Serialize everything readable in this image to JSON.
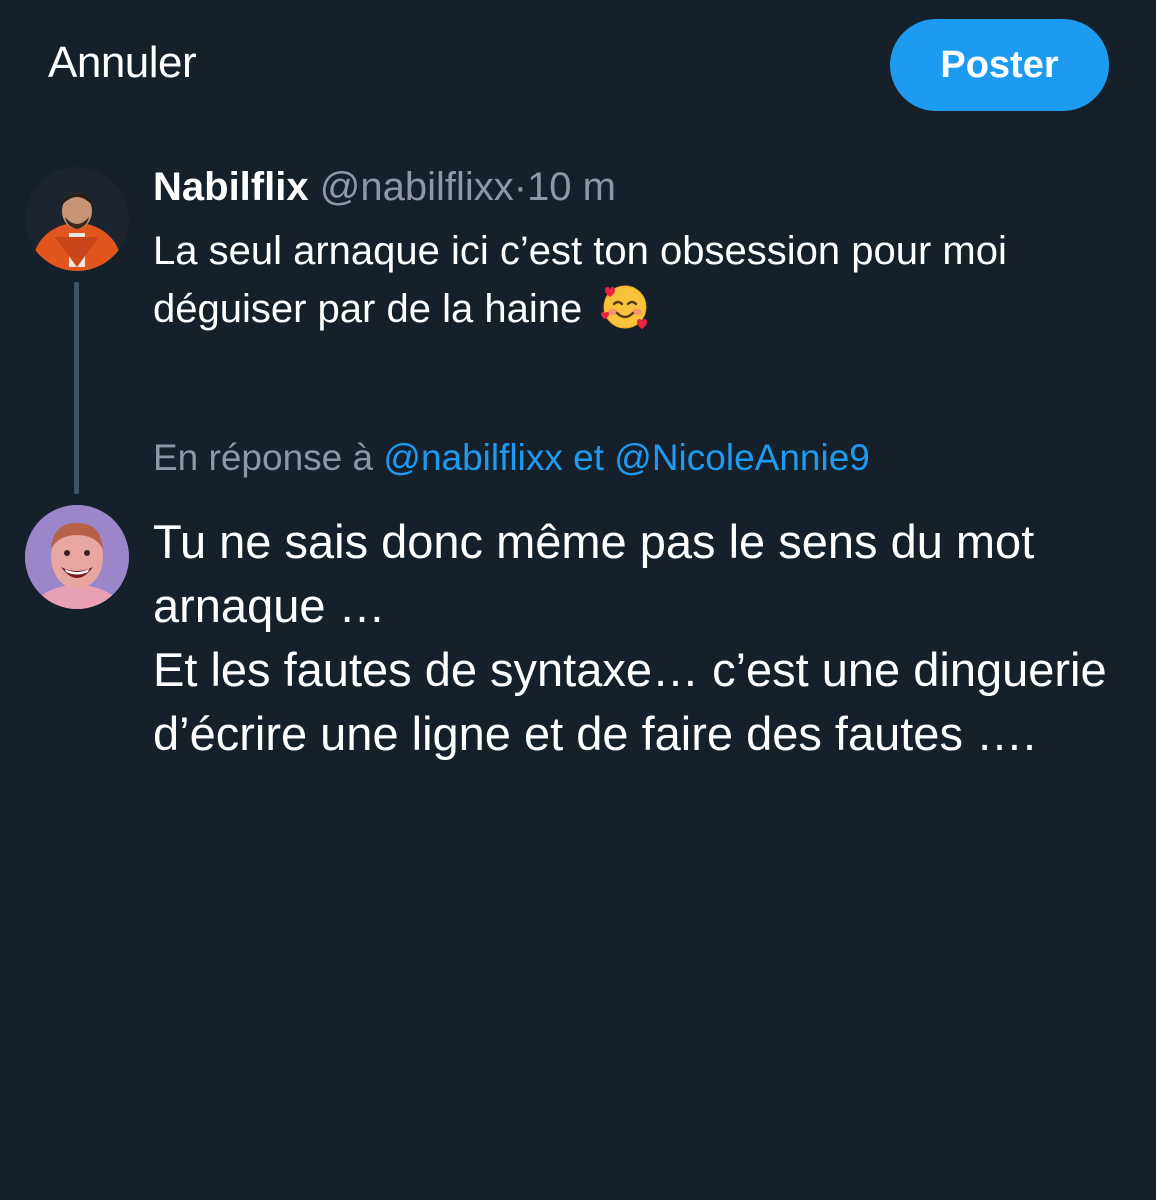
{
  "header": {
    "cancel_label": "Annuler",
    "post_label": "Poster"
  },
  "original_tweet": {
    "display_name": "Nabilflix",
    "handle": "@nabilflixx",
    "separator": "·",
    "time": "10 m",
    "text": "La seul arnaque ici c’est ton obsession pour moi déguiser par de la haine",
    "emoji": "smiling-face-with-hearts"
  },
  "reply_context": {
    "prefix": "En réponse à",
    "mention_1": "@nabilflixx",
    "conjunction": "et",
    "mention_2": "@NicoleAnnie9"
  },
  "compose": {
    "line_1": "Tu ne sais donc même pas le sens du mot arnaque …",
    "line_2": "Et les fautes de syntaxe… c’est une dinguerie d’écrire une ligne et de faire des fautes …."
  },
  "colors": {
    "background": "#15202b",
    "accent": "#1d9bf0",
    "secondary_text": "#8b98a5",
    "thread_line": "#3d5466"
  }
}
